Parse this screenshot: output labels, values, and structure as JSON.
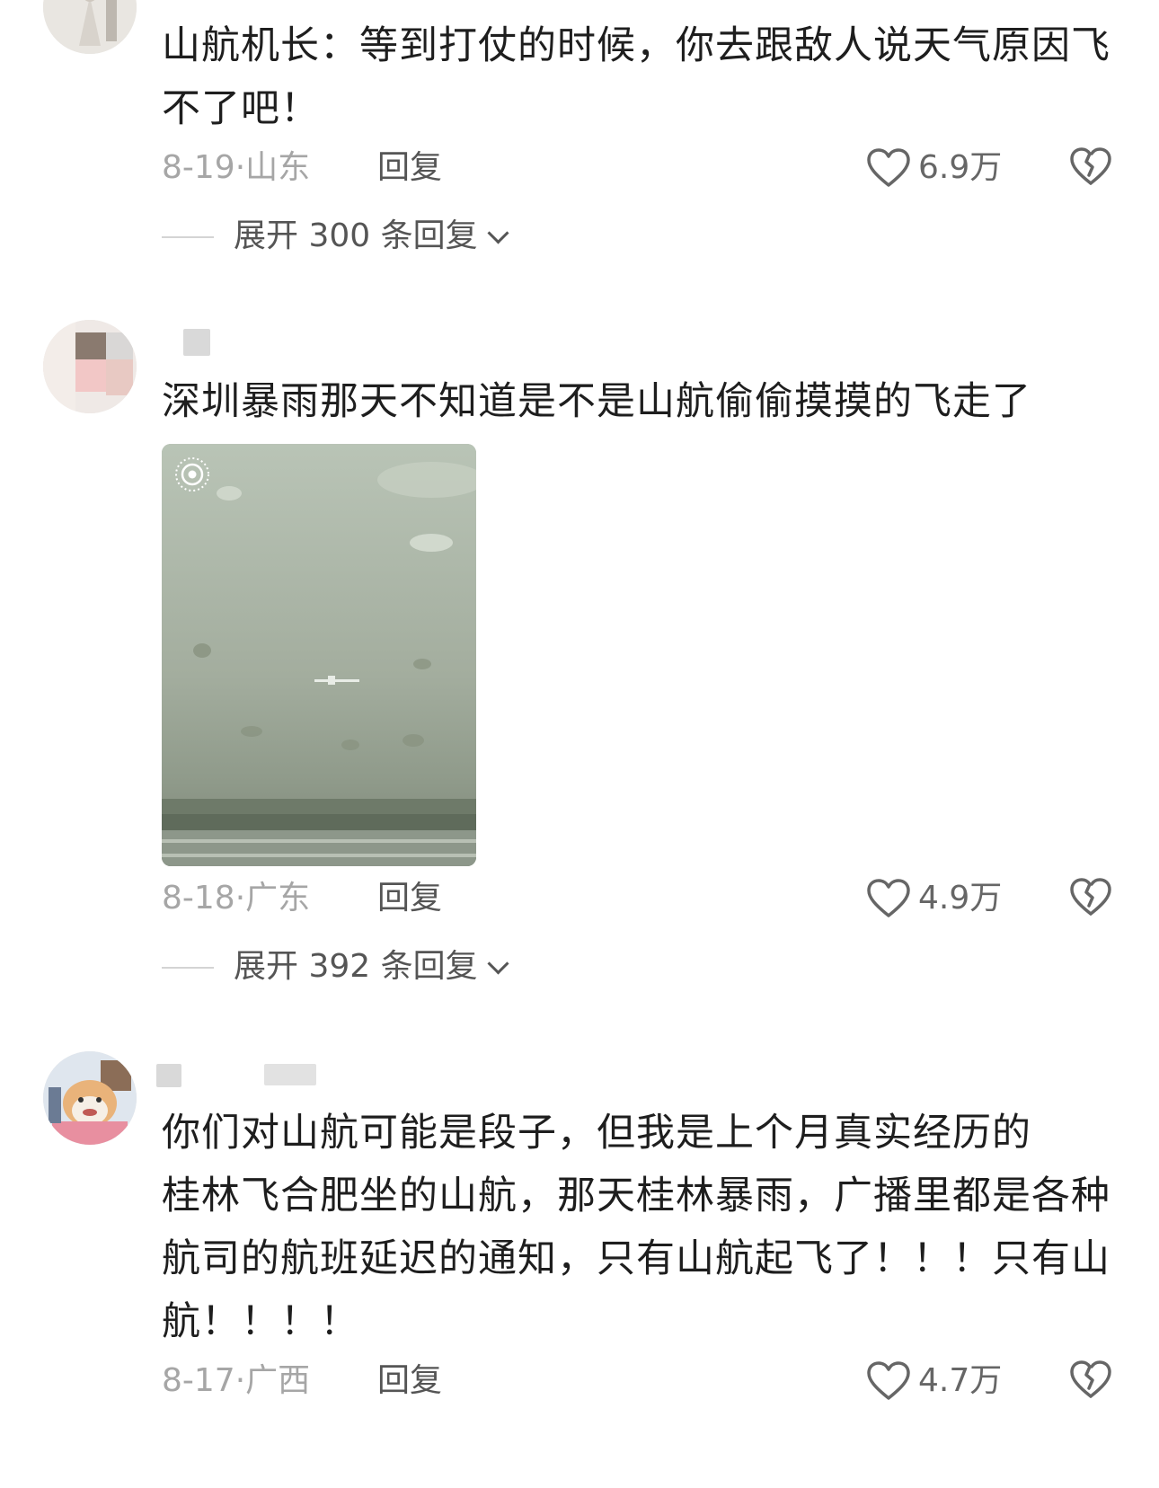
{
  "comments": [
    {
      "text": "山航机长：等到打仗的时候，你去跟敌人说天气原因飞不了吧！",
      "date_location": "8-19·山东",
      "reply_label": "回复",
      "likes": "6.9万",
      "expand_label": "展开 300 条回复"
    },
    {
      "text": "深圳暴雨那天不知道是不是山航偷偷摸摸的飞走了",
      "date_location": "8-18·广东",
      "reply_label": "回复",
      "likes": "4.9万",
      "expand_label": "展开 392 条回复"
    },
    {
      "text": "你们对山航可能是段子，但我是上个月真实经历的\n桂林飞合肥坐的山航，那天桂林暴雨，广播里都是各种航司的航班延迟的通知，只有山航起飞了！！！只有山航！！！！",
      "date_location": "8-17·广西",
      "reply_label": "回复",
      "likes": "4.7万"
    }
  ],
  "icons": {
    "like": "heart-outline-icon",
    "dislike": "broken-heart-icon",
    "expand": "chevron-down-icon",
    "live_photo": "live-photo-icon"
  },
  "colors": {
    "text": "#1e1e1e",
    "meta": "#a6a6a6",
    "secondary": "#555555"
  }
}
